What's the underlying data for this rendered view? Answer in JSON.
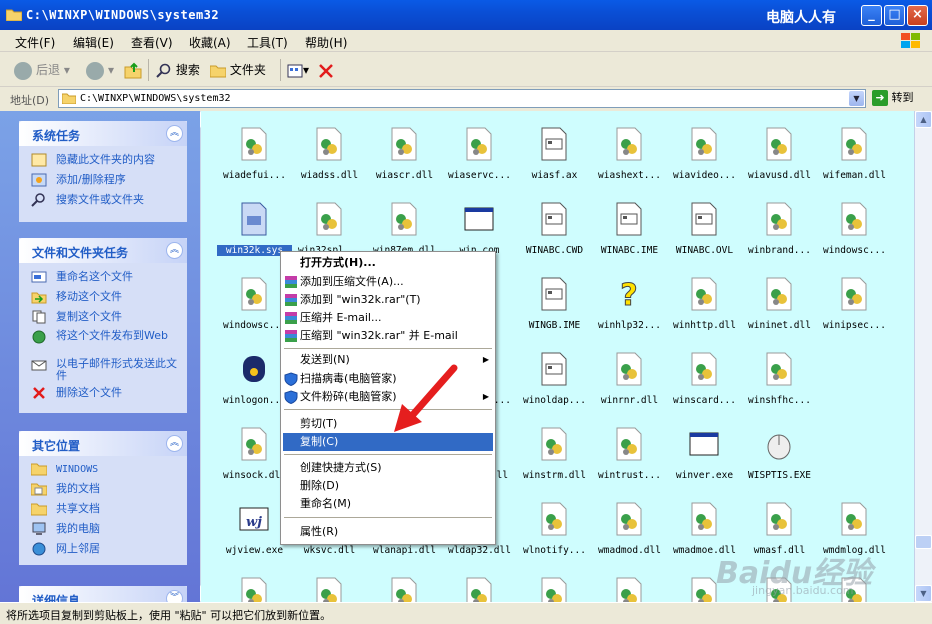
{
  "window": {
    "title": "C:\\WINXP\\WINDOWS\\system32",
    "brand": "电脑人人有",
    "buttons": {
      "minimize": "_",
      "maximize": "□",
      "close": "×"
    }
  },
  "menubar": [
    "文件(F)",
    "编辑(E)",
    "查看(V)",
    "收藏(A)",
    "工具(T)",
    "帮助(H)"
  ],
  "toolbar": {
    "back": "后退",
    "search": "搜索",
    "folders": "文件夹"
  },
  "address": {
    "label": "地址(D)",
    "value": "C:\\WINXP\\WINDOWS\\system32",
    "go": "转到"
  },
  "panels": {
    "system": {
      "title": "系统任务",
      "items": [
        "隐藏此文件夹的内容",
        "添加/删除程序",
        "搜索文件或文件夹"
      ]
    },
    "file": {
      "title": "文件和文件夹任务",
      "items": [
        "重命名这个文件",
        "移动这个文件",
        "复制这个文件",
        "将这个文件发布到Web",
        "以电子邮件形式发送此文件",
        "删除这个文件"
      ]
    },
    "other": {
      "title": "其它位置",
      "items": [
        "WINDOWS",
        "我的文档",
        "共享文档",
        "我的电脑",
        "网上邻居"
      ]
    },
    "details": {
      "title": "详细信息"
    }
  },
  "files": [
    [
      "wiadefui...",
      "wiadss.dll",
      "wiascr.dll",
      "wiaservc...",
      "wiasf.ax",
      "wiashext...",
      "wiavideo...",
      "wiavusd.dll",
      "wifeman.dll"
    ],
    [
      "win32k.sys",
      "win32spl...",
      "win87em.dll",
      "win.com",
      "WINABC.CWD",
      "WINABC.IME",
      "WINABC.OVL",
      "winbrand...",
      "windowsc..."
    ],
    [
      "windowsc...",
      "",
      "",
      "",
      "WINGB.IME",
      "winhlp32...",
      "winhttp.dll",
      "wininet.dll",
      "winipsec..."
    ],
    [
      "winlogon...",
      "",
      "",
      "winntbbu...",
      "winoldap...",
      "winrnr.dll",
      "winscard...",
      "winshfhc...",
      ""
    ],
    [
      "winsock.dll",
      "",
      "",
      "winsta.dll",
      "winstrm.dll",
      "wintrust...",
      "winver.exe",
      "WISPTIS.EXE",
      ""
    ],
    [
      "wjview.exe",
      "wksvc.dll",
      "wlanapi.dll",
      "wldap32.dll",
      "wlnotify...",
      "wmadmod.dll",
      "wmadmoe.dll",
      "wmasf.dll",
      "wmdmlog.dll"
    ]
  ],
  "context_menu": {
    "open_with": "打开方式(H)...",
    "add_archive": "添加到压缩文件(A)...",
    "add_rar": "添加到 \"win32k.rar\"(T)",
    "compress_email": "压缩并 E-mail...",
    "compress_rar_email": "压缩到 \"win32k.rar\" 并 E-mail",
    "send_to": "发送到(N)",
    "scan_virus": "扫描病毒(电脑管家)",
    "shred": "文件粉碎(电脑管家)",
    "cut": "剪切(T)",
    "copy": "复制(C)",
    "shortcut": "创建快捷方式(S)",
    "delete": "删除(D)",
    "rename": "重命名(M)",
    "properties": "属性(R)"
  },
  "status": "将所选项目复制到剪贴板上，使用 \"粘贴\" 可以把它们放到新位置。",
  "watermark": {
    "main": "Baidu经验",
    "sub": "jingyan.baidu.com"
  },
  "colors": {
    "title_blue": "#0a4fd6",
    "file_bg": "#cffdfe",
    "highlight": "#316ac5",
    "arrow_red": "#e51e1e"
  }
}
